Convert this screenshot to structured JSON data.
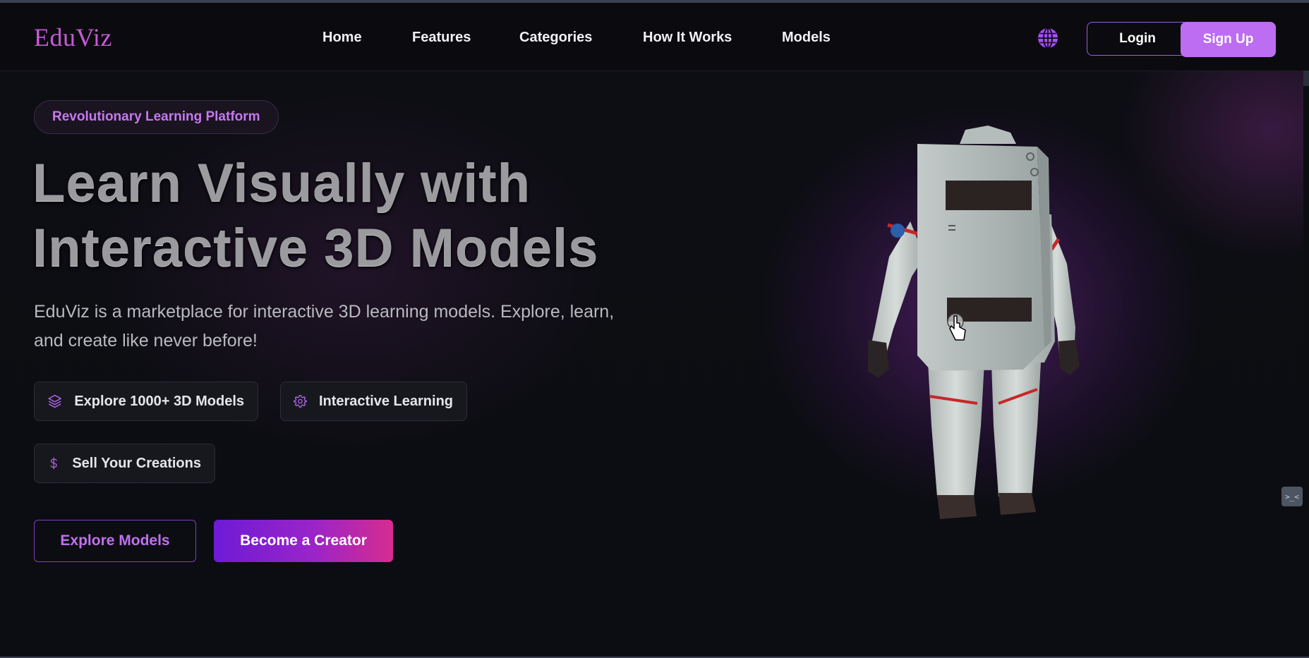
{
  "header": {
    "logo": "EduViz",
    "nav": [
      "Home",
      "Features",
      "Categories",
      "How It Works",
      "Models"
    ],
    "globe_icon": "globe-icon",
    "login_label": "Login",
    "signup_label": "Sign Up"
  },
  "hero": {
    "badge": "Revolutionary Learning Platform",
    "title_line1": "Learn Visually with",
    "title_line2": "Interactive 3D Models",
    "description": "EduViz is a marketplace for interactive 3D learning models. Explore, learn, and create like never before!",
    "features": [
      {
        "label": "Explore 1000+ 3D Models",
        "icon": "layers-icon"
      },
      {
        "label": "Interactive Learning",
        "icon": "gear-icon"
      },
      {
        "label": "Sell Your Creations",
        "icon": "dollar-icon"
      }
    ],
    "explore_label": "Explore Models",
    "creator_label": "Become a Creator"
  },
  "side_widget": {
    "label": ">_<"
  },
  "colors": {
    "accent": "#bc6df2",
    "accent_dark": "#7d3fb8",
    "gradient_start": "#6d1bd6",
    "gradient_end": "#d62c8f",
    "background": "#0b0c10"
  }
}
